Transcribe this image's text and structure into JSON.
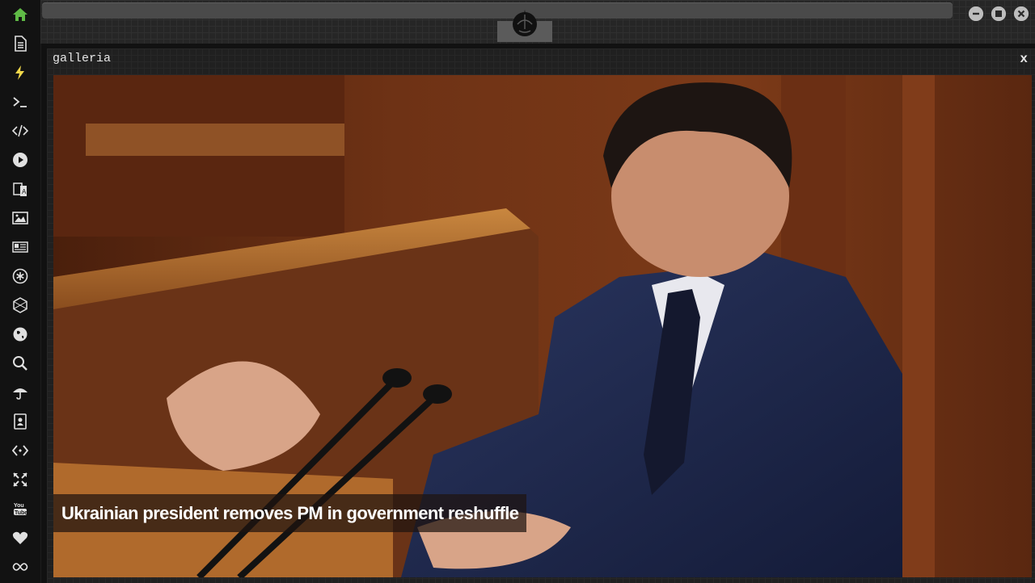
{
  "sidebar": {
    "items": [
      {
        "name": "home-icon",
        "active": true
      },
      {
        "name": "document-icon"
      },
      {
        "name": "lightning-icon"
      },
      {
        "name": "terminal-icon"
      },
      {
        "name": "code-icon"
      },
      {
        "name": "play-icon"
      },
      {
        "name": "translate-icon"
      },
      {
        "name": "image-icon"
      },
      {
        "name": "newspaper-icon"
      },
      {
        "name": "asterisk-icon"
      },
      {
        "name": "hexagon-icon"
      },
      {
        "name": "globe-icon"
      },
      {
        "name": "search-icon"
      },
      {
        "name": "umbrella-icon"
      },
      {
        "name": "contacts-icon"
      },
      {
        "name": "embed-icon"
      },
      {
        "name": "expand-icon"
      },
      {
        "name": "youtube-icon"
      },
      {
        "name": "heart-icon"
      },
      {
        "name": "infinity-icon"
      }
    ],
    "accent": "#5fba46"
  },
  "window": {
    "title": "galleria",
    "close_label": "x"
  },
  "gallery": {
    "caption": "Ukrainian president removes PM in government reshuffle"
  }
}
